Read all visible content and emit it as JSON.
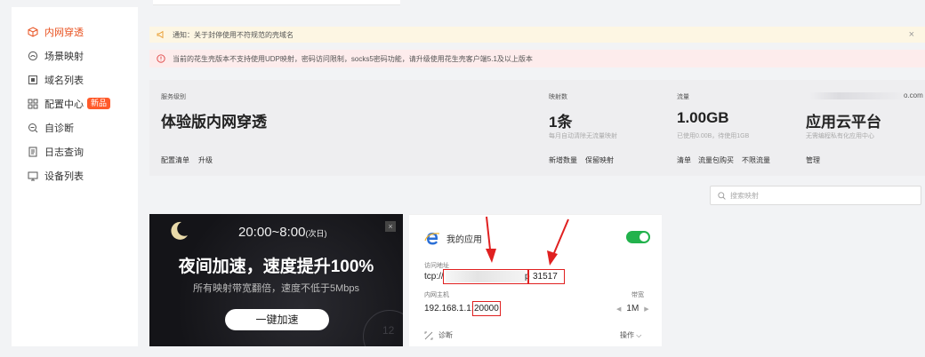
{
  "sidebar": {
    "items": [
      {
        "label": "内网穿透",
        "icon": "cube-icon",
        "active": true
      },
      {
        "label": "场景映射",
        "icon": "cloud-icon"
      },
      {
        "label": "域名列表",
        "icon": "domain-icon"
      },
      {
        "label": "配置中心",
        "icon": "grid-icon",
        "badge": "新品"
      },
      {
        "label": "自诊断",
        "icon": "diagnose-icon"
      },
      {
        "label": "日志查询",
        "icon": "log-icon"
      },
      {
        "label": "设备列表",
        "icon": "monitor-icon"
      }
    ]
  },
  "notices": {
    "yellow": "通知：关于封停使用不符规范的壳域名",
    "red": "当前的花生壳版本不支持使用UDP映射，密码访问限制，socks5密码功能，请升级使用花生壳客户端5.1及以上版本"
  },
  "panel": {
    "service_label": "服务级别",
    "service_value": "体验版内网穿透",
    "service_links": [
      "配置清单",
      "升级"
    ],
    "mapping_label": "映射数",
    "mapping_value": "1条",
    "mapping_sub": "每月自动清除无流量映射",
    "mapping_links": [
      "新增数量",
      "保留映射"
    ],
    "traffic_label": "流量",
    "traffic_value": "1.00GB",
    "traffic_sub": "已使用0.00B，待使用1GB",
    "traffic_links": [
      "清单",
      "流量包购买",
      "不限流量"
    ],
    "cloud_suffix": "o.com",
    "cloud_value": "应用云平台",
    "cloud_sub": "无需编程私有化应用中心",
    "cloud_link": "管理"
  },
  "search": {
    "placeholder": "搜索映射"
  },
  "promo": {
    "time": "20:00~8:00",
    "time_suffix": "(次日)",
    "title": "夜间加速，速度提升100%",
    "subtitle": "所有映射带宽翻倍，速度不低于5Mbps",
    "button": "一键加速",
    "clock_number": "12"
  },
  "app_card": {
    "name": "我的应用",
    "address_label": "访问地址",
    "address_prefix": "tcp://",
    "address_partial": "p",
    "address_port": "31517",
    "host_label": "内网主机",
    "host_ip": "192.168.1.1:",
    "host_port": "20000",
    "bandwidth_label": "带宽",
    "bandwidth_value": "1M",
    "diagnose": "诊断",
    "operation": "操作",
    "toggle_on": true
  },
  "colors": {
    "accent": "#e8501e",
    "toggle": "#22b24c",
    "annotation": "#e02020"
  }
}
